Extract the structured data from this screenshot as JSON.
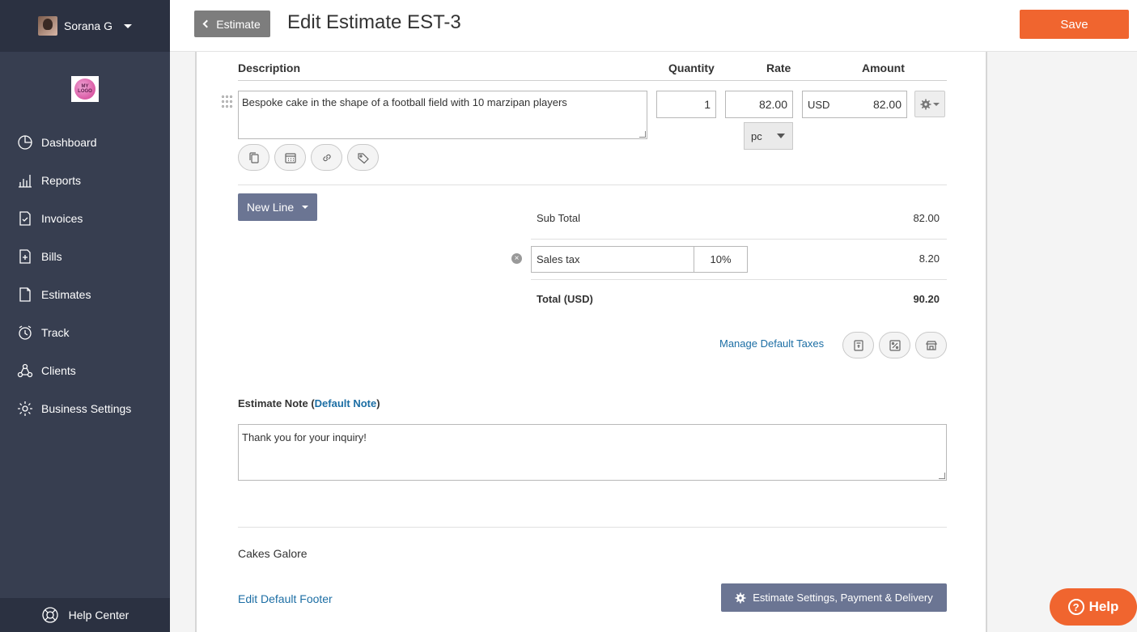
{
  "sidebar": {
    "user_name": "Sorana G",
    "logo_text": "MY LOGO",
    "items": [
      {
        "label": "Dashboard",
        "icon": "dashboard-icon"
      },
      {
        "label": "Reports",
        "icon": "reports-icon"
      },
      {
        "label": "Invoices",
        "icon": "invoices-icon"
      },
      {
        "label": "Bills",
        "icon": "bills-icon"
      },
      {
        "label": "Estimates",
        "icon": "estimates-icon"
      },
      {
        "label": "Track",
        "icon": "track-icon"
      },
      {
        "label": "Clients",
        "icon": "clients-icon"
      },
      {
        "label": "Business Settings",
        "icon": "gear-icon"
      }
    ],
    "help_center": "Help Center"
  },
  "header": {
    "back_label": "Estimate",
    "title": "Edit Estimate EST-3",
    "save_label": "Save"
  },
  "table": {
    "columns": {
      "description": "Description",
      "quantity": "Quantity",
      "rate": "Rate",
      "amount": "Amount"
    },
    "line": {
      "description": "Bespoke cake in the shape of a football field with 10 marzipan players",
      "quantity": "1",
      "rate": "82.00",
      "currency": "USD",
      "amount": "82.00",
      "unit": "pc"
    }
  },
  "new_line_label": "New Line",
  "totals": {
    "subtotal_label": "Sub Total",
    "subtotal_value": "82.00",
    "tax_name": "Sales tax",
    "tax_rate": "10%",
    "tax_value": "8.20",
    "total_label": "Total (USD)",
    "total_value": "90.20"
  },
  "manage_taxes_label": "Manage Default Taxes",
  "note": {
    "label": "Estimate Note",
    "default_link": "Default Note",
    "text": "Thank you for your inquiry!"
  },
  "footer": {
    "company": "Cakes Galore",
    "edit_footer_link": "Edit Default Footer",
    "settings_label": "Estimate Settings, Payment & Delivery"
  },
  "help_button": "Help",
  "colors": {
    "accent": "#f0652f",
    "sidebar": "#373e50",
    "link": "#1c6ea4",
    "button": "#6b7593"
  }
}
